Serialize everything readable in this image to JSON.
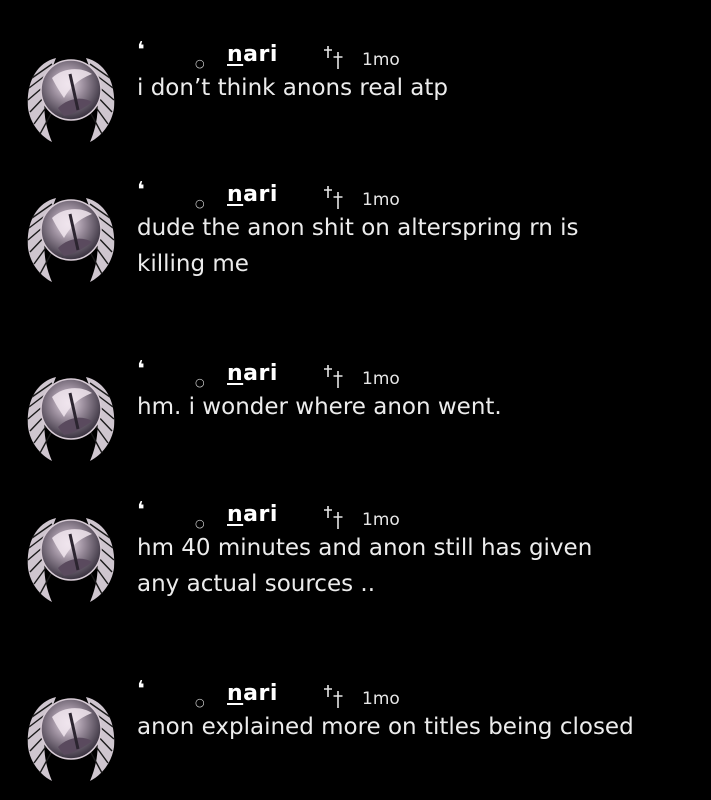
{
  "posts": [
    {
      "username_first": "n",
      "username_rest": "ari",
      "time": "1mo",
      "text": "i don’t think anons real atp"
    },
    {
      "username_first": "n",
      "username_rest": "ari",
      "time": "1mo",
      "text": "dude the anon shit on alterspring rn is killing me"
    },
    {
      "username_first": "n",
      "username_rest": "ari",
      "time": "1mo",
      "text": "hm. i wonder where anon went."
    },
    {
      "username_first": "n",
      "username_rest": "ari",
      "time": "1mo",
      "text": "hm 40 minutes and anon still has given any actual sources .."
    },
    {
      "username_first": "n",
      "username_rest": "ari",
      "time": "1mo",
      "text": "anon explained more on titles being closed"
    }
  ],
  "icons": {
    "avatar": "winged-avatar-icon",
    "comma": "comma-mark-icon",
    "ring": "ring-mark-icon",
    "cross": "double-cross-icon"
  },
  "colors": {
    "background": "#000000",
    "text": "#ececec"
  }
}
